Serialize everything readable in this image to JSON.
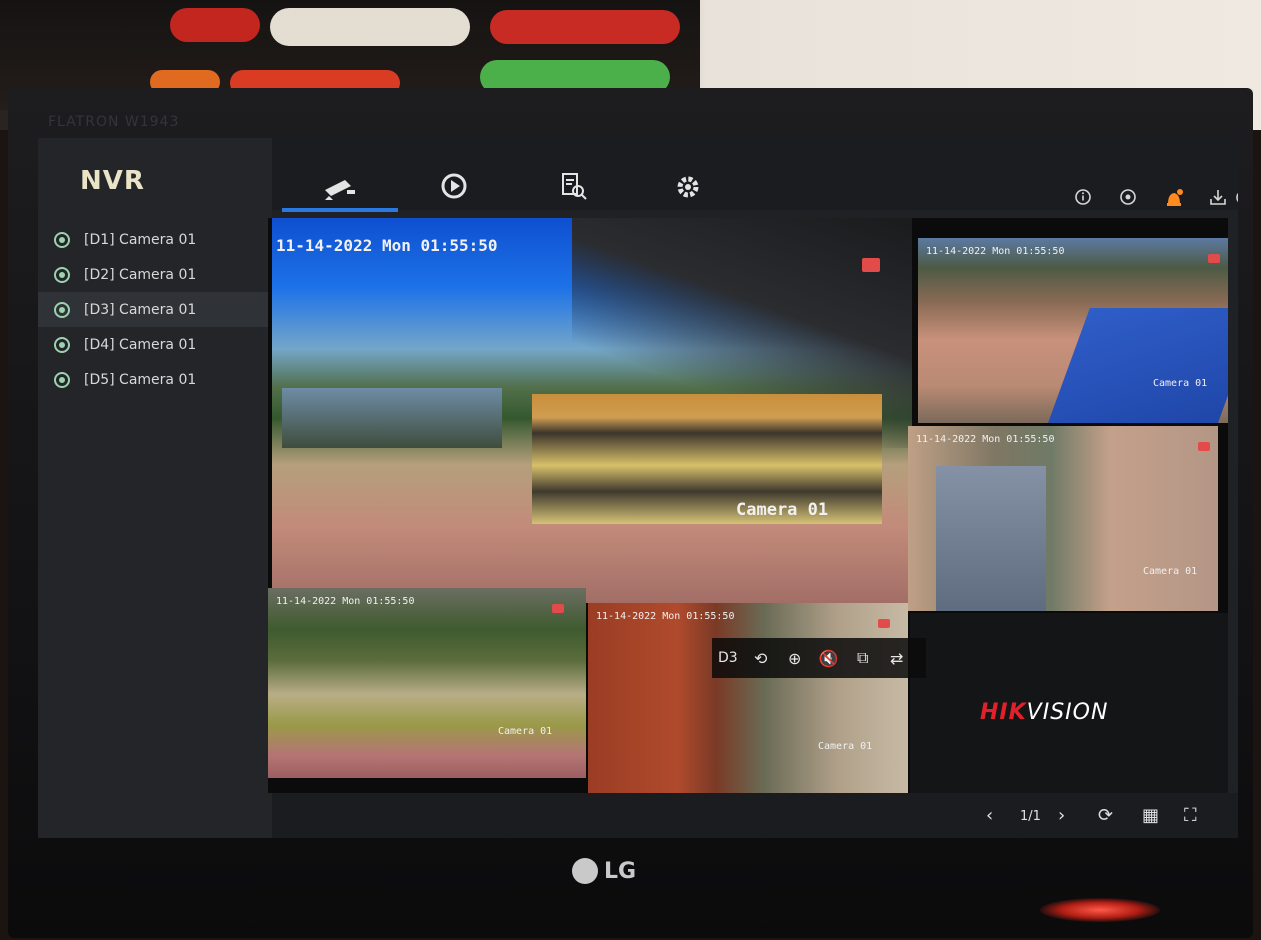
{
  "sidebar": {
    "logo": "NVR",
    "cameras": [
      {
        "label": "[D1] Camera 01"
      },
      {
        "label": "[D2] Camera 01"
      },
      {
        "label": "[D3] Camera 01"
      },
      {
        "label": "[D4] Camera 01"
      },
      {
        "label": "[D5] Camera 01"
      }
    ],
    "active_index": 2
  },
  "topbar": {
    "tabs": [
      {
        "name": "live-view",
        "icon": "camera-icon"
      },
      {
        "name": "playback",
        "icon": "playback-icon"
      },
      {
        "name": "search",
        "icon": "file-search-icon"
      },
      {
        "name": "settings",
        "icon": "gear-icon"
      }
    ],
    "right_icons": [
      "info-icon",
      "record-icon",
      "alarm-icon",
      "download-icon",
      "power-icon"
    ]
  },
  "tiles": {
    "main": {
      "timestamp": "11-14-2022 Mon 01:55:50",
      "label": "Camera 01"
    },
    "top_right": {
      "timestamp": "11-14-2022 Mon 01:55:50",
      "label": "Camera 01"
    },
    "mid_right": {
      "timestamp": "11-14-2022 Mon 01:55:50",
      "label": "Camera 01"
    },
    "bottom_left": {
      "timestamp": "11-14-2022 Mon 01:55:50",
      "label": "Camera 01"
    },
    "bottom_mid": {
      "timestamp": "11-14-2022 Mon 01:55:50",
      "label": "Camera 01"
    }
  },
  "overlay_toolbar": {
    "channel": "D3",
    "buttons": [
      "instant-playback-icon",
      "zoom-icon",
      "mute-icon",
      "ptz-icon",
      "switch-stream-icon"
    ]
  },
  "brand": {
    "part1": "HIK",
    "part2": "VISION"
  },
  "bottombar": {
    "page": "1/1"
  },
  "monitor": {
    "brand_text": "FLATRON W1943",
    "maker": "LG"
  }
}
